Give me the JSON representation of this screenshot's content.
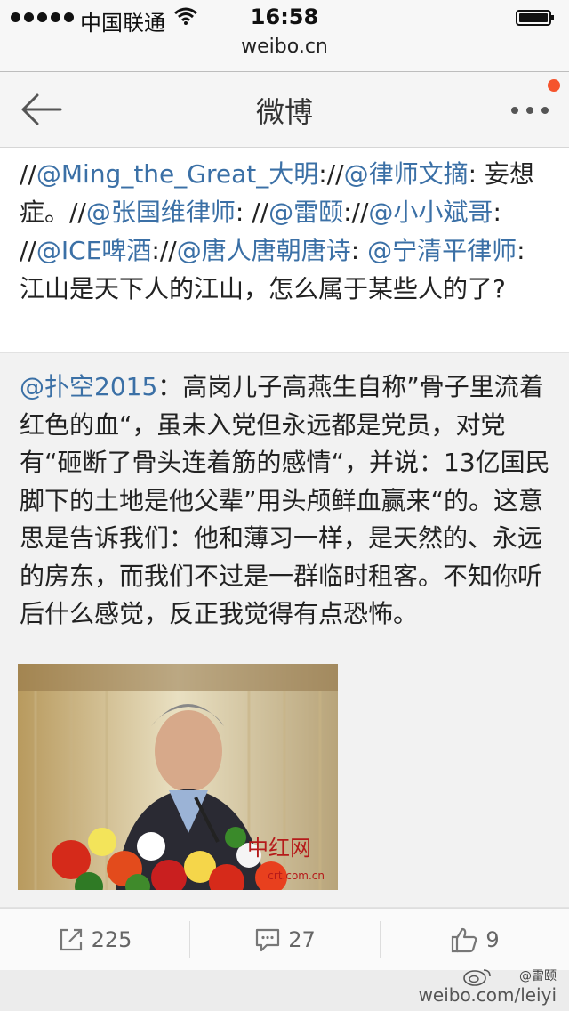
{
  "status": {
    "carrier": "中国联通",
    "time": "16:58"
  },
  "browser": {
    "url": "weibo.cn"
  },
  "header": {
    "title": "微博"
  },
  "repost": {
    "segments": [
      {
        "text": "//",
        "mention": false
      },
      {
        "text": "@Ming_the_Great_大明",
        "mention": true
      },
      {
        "text": "://",
        "mention": false
      },
      {
        "text": "@律师文摘",
        "mention": true
      },
      {
        "text": ": 妄想症。//",
        "mention": false
      },
      {
        "text": "@张国维律师",
        "mention": true
      },
      {
        "text": ": //",
        "mention": false
      },
      {
        "text": "@雷颐",
        "mention": true
      },
      {
        "text": "://",
        "mention": false
      },
      {
        "text": "@小小斌哥",
        "mention": true
      },
      {
        "text": ": //",
        "mention": false
      },
      {
        "text": "@ICE啤酒",
        "mention": true
      },
      {
        "text": "://",
        "mention": false
      },
      {
        "text": "@唐人唐朝唐诗",
        "mention": true
      },
      {
        "text": ": ",
        "mention": false
      },
      {
        "text": "@宁清平律师",
        "mention": true
      },
      {
        "text": ": 江山是天下人的江山，怎么属于某些人的了?",
        "mention": false
      }
    ]
  },
  "original": {
    "author": "@扑空2015",
    "text": "：高岗儿子高燕生自称”骨子里流着红色的血“，虽未入党但永远都是党员，对党有“砸断了骨头连着筋的感情“，并说：13亿国民脚下的土地是他父辈”用头颅鲜血赢来“的。这意思是告诉我们：他和薄习一样，是天然的、永远的房东，而我们不过是一群临时租客。不知你听后什么感觉，反正我觉得有点恐怖。",
    "photo_watermark": "中红网",
    "photo_watermark_url": "crt.com.cn"
  },
  "actions": {
    "repost_count": "225",
    "comment_count": "27",
    "like_count": "9"
  },
  "watermark": {
    "handle": "@雷颐",
    "url": "weibo.com/leiyi"
  },
  "colors": {
    "mention": "#3b70a6",
    "notification": "#f5542d"
  }
}
